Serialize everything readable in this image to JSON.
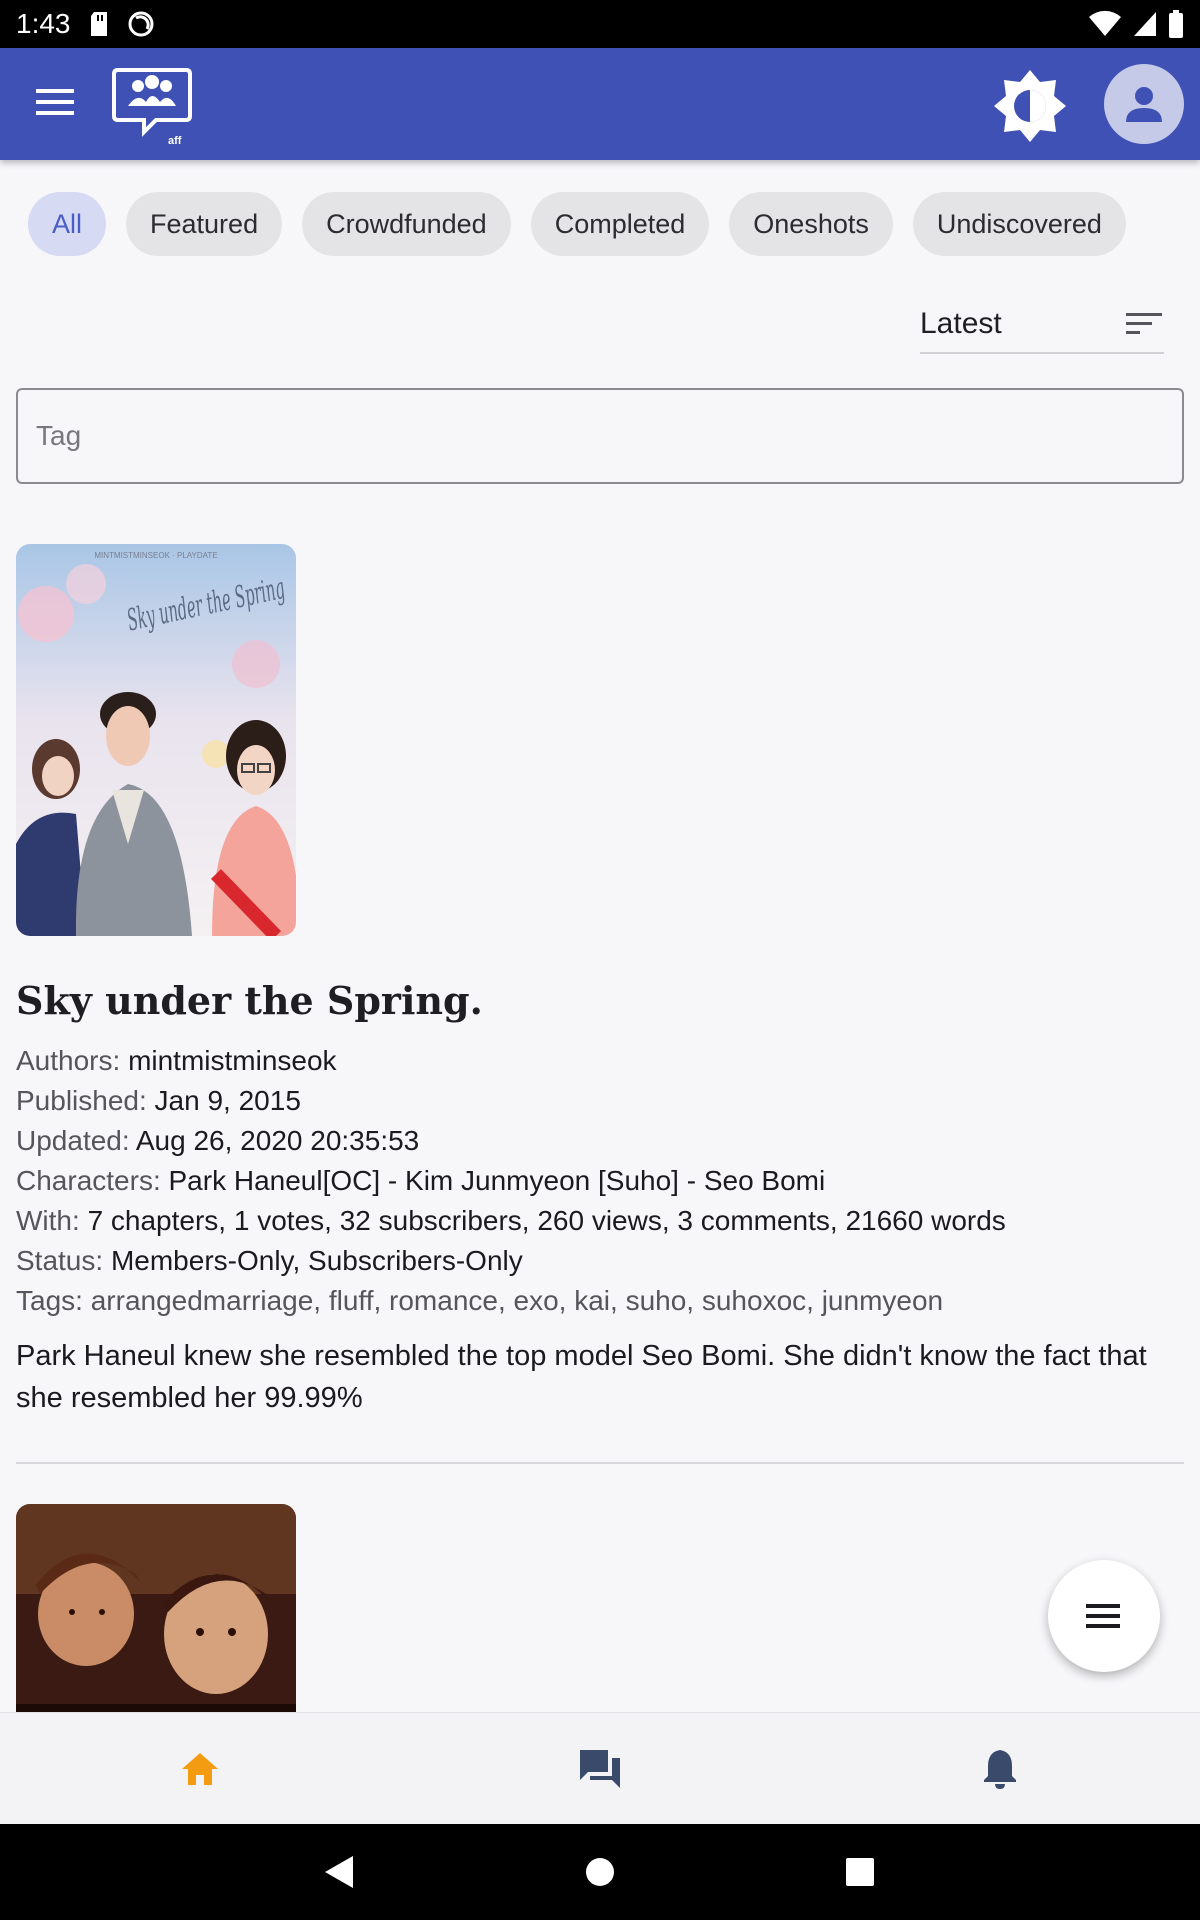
{
  "status_bar": {
    "time": "1:43"
  },
  "filters": {
    "chips": [
      {
        "label": "All",
        "active": true
      },
      {
        "label": "Featured",
        "active": false
      },
      {
        "label": "Crowdfunded",
        "active": false
      },
      {
        "label": "Completed",
        "active": false
      },
      {
        "label": "Oneshots",
        "active": false
      },
      {
        "label": "Undiscovered",
        "active": false
      }
    ],
    "sort_label": "Latest",
    "tag_placeholder": "Tag"
  },
  "story": {
    "title": "Sky under the Spring.",
    "cover_text": "Sky under the Spring",
    "cover_caption": "MINTMISTMINSEOK · PLAYDATE",
    "authors_key": "Authors:",
    "authors": "mintmistminseok",
    "published_key": "Published:",
    "published": "Jan 9, 2015",
    "updated_key": "Updated:",
    "updated": "Aug 26, 2020 20:35:53",
    "characters_key": "Characters:",
    "characters": "Park Haneul[OC] - Kim Junmyeon [Suho] - Seo Bomi",
    "with_key": "With:",
    "with": "7 chapters, 1 votes, 32 subscribers, 260 views, 3 comments, 21660 words",
    "status_key": "Status:",
    "status": "Members-Only, Subscribers-Only",
    "tags_key": "Tags:",
    "tags": "arrangedmarriage, fluff, romance, exo, kai, suho, suhoxoc, junmyeon",
    "description": "Park Haneul knew she resembled the top model Seo Bomi.  She didn't know the fact that she resembled her 99.99%"
  },
  "colors": {
    "app_bar": "#3f51b5",
    "active_chip_bg": "#d6daf3",
    "active_chip_text": "#4a5cc5",
    "home_active": "#f39c12",
    "nav_inactive": "#3a4a6b"
  },
  "icons": {
    "menu": "menu-icon",
    "logo": "aff-logo",
    "theme": "brightness-icon",
    "account": "person-icon",
    "sort": "sort-icon",
    "fab": "menu-icon",
    "nav_home": "home-icon",
    "nav_forum": "forum-icon",
    "nav_notifications": "bell-icon"
  }
}
